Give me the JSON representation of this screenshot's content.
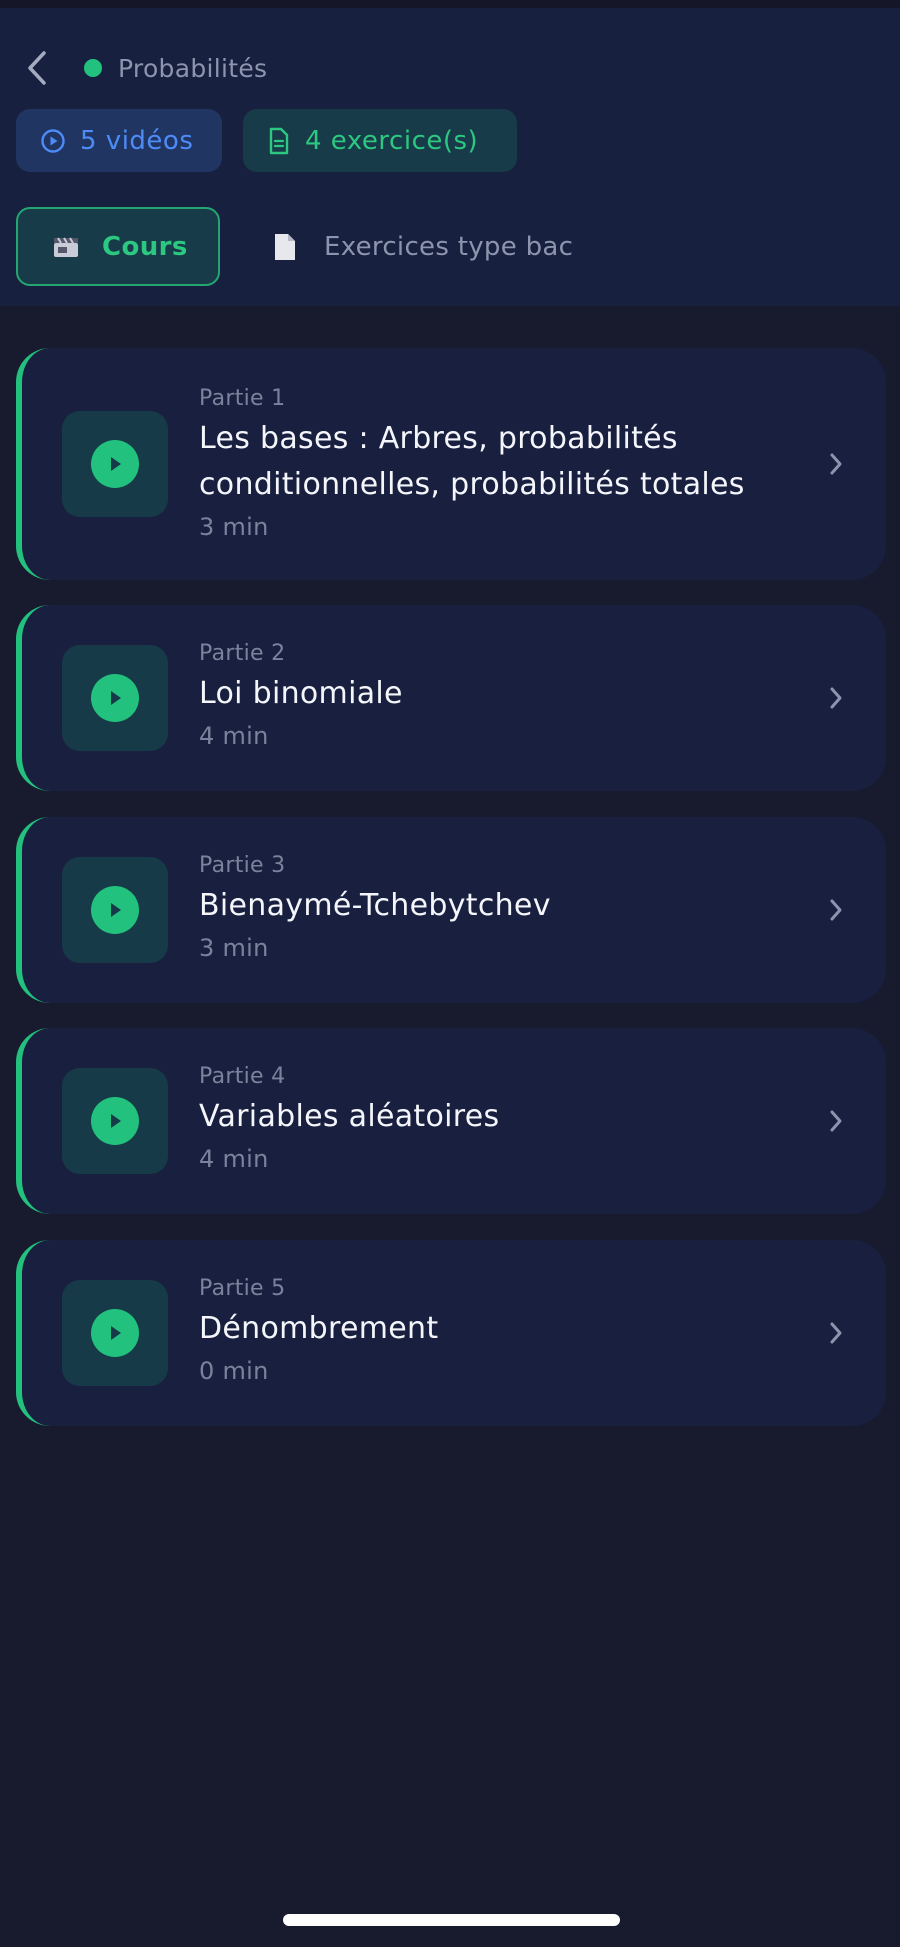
{
  "header": {
    "breadcrumb": "Probabilités",
    "chips": {
      "videos": "5 vidéos",
      "exercises": "4 exercice(s)"
    },
    "tabs": {
      "cours": "Cours",
      "exercices": "Exercices type bac"
    }
  },
  "lessons": [
    {
      "part": "Partie 1",
      "title_line1": "Les bases : Arbres, probabilités",
      "title_line2": "conditionnelles, probabilités totales",
      "duration": "3 min"
    },
    {
      "part": "Partie 2",
      "title_line1": "Loi binomiale",
      "duration": "4 min"
    },
    {
      "part": "Partie 3",
      "title_line1": "Bienaymé-Tchebytchev",
      "duration": "3 min"
    },
    {
      "part": "Partie 4",
      "title_line1": "Variables aléatoires",
      "duration": "4 min"
    },
    {
      "part": "Partie 5",
      "title_line1": "Dénombrement",
      "duration": "0 min"
    }
  ],
  "colors": {
    "accent": "#22c27e",
    "blue_chip": "#4d8bf6",
    "background": "#181a2e",
    "card": "#19203f"
  }
}
